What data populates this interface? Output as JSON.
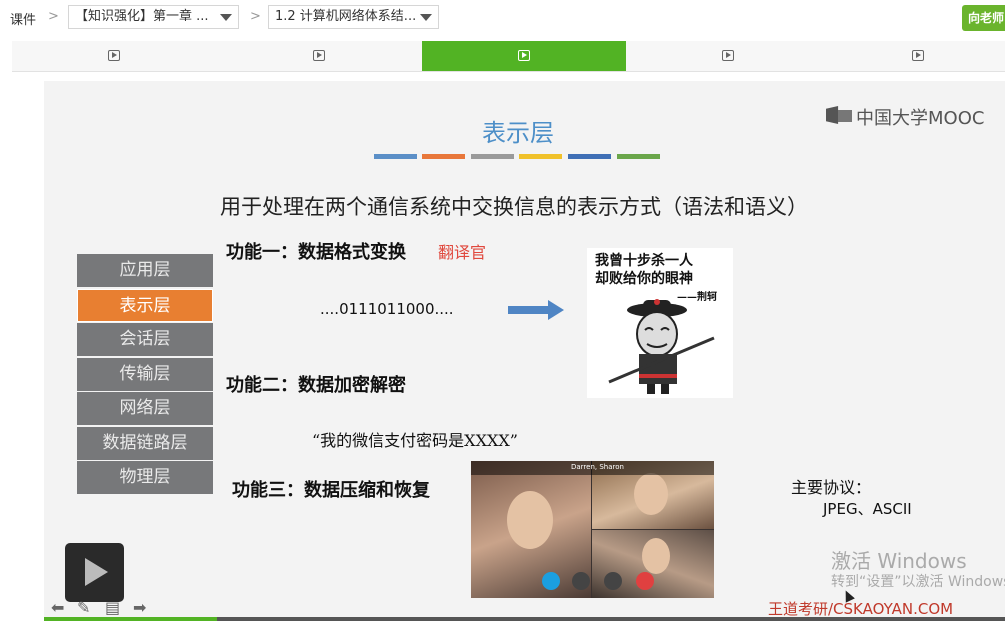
{
  "breadcrumb": {
    "root_label": "课件",
    "chapter_value": "【知识强化】第一章 ...",
    "section_value": "1.2 计算机网络体系结...",
    "separator": ">"
  },
  "ask_button": {
    "label": "向老师"
  },
  "tabs": [
    {
      "icon": "play-icon",
      "active": false
    },
    {
      "icon": "play-icon",
      "active": false
    },
    {
      "icon": "play-icon",
      "active": true
    },
    {
      "icon": "play-icon",
      "active": false
    },
    {
      "icon": "play-icon",
      "active": false
    }
  ],
  "slide": {
    "title": "表示层",
    "title_bar_colors": [
      "#5b8fc7",
      "#e8773a",
      "#9a9a9a",
      "#f0c12a",
      "#3f6fb5",
      "#6aa64a"
    ],
    "logo_text": "中国大学MOOC",
    "description": "用于处理在两个通信系统中交换信息的表示方式（语法和语义）",
    "layers": [
      "应用层",
      "表示层",
      "会话层",
      "传输层",
      "网络层",
      "数据链路层",
      "物理层"
    ],
    "highlighted_layer": "表示层",
    "function1": "功能一：数据格式变换",
    "function1_note": "翻译官",
    "bit_string": "....0111011000....",
    "meme_caption_line1": "我曾十步杀一人",
    "meme_caption_line2": "却败给你的眼神",
    "meme_signature": "——荆轲",
    "function2": "功能二：数据加密解密",
    "function2_example": "“我的微信支付密码是XXXX”",
    "function3": "功能三：数据压缩和恢复",
    "video_caller": "Darren, Sharon",
    "protocols_label": "主要协议：",
    "protocols_value": "JPEG、ASCII",
    "activation_line1": "激活 Windows",
    "activation_line2": "转到“设置”以激活 Windows",
    "brand": "王道考研/CSKAOYAN.COM"
  },
  "player": {
    "progress_fraction": 0.18,
    "accent_color": "#52b324"
  }
}
